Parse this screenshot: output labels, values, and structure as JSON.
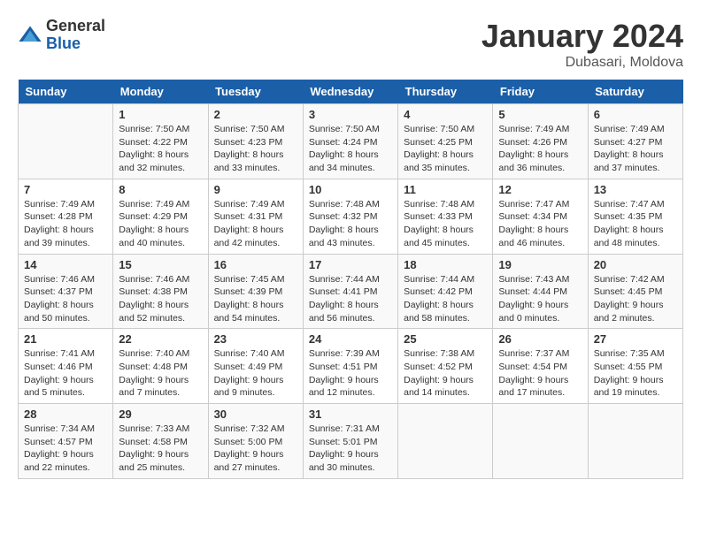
{
  "header": {
    "logo_general": "General",
    "logo_blue": "Blue",
    "month_title": "January 2024",
    "location": "Dubasari, Moldova"
  },
  "weekdays": [
    "Sunday",
    "Monday",
    "Tuesday",
    "Wednesday",
    "Thursday",
    "Friday",
    "Saturday"
  ],
  "weeks": [
    [
      {
        "day": "",
        "sunrise": "",
        "sunset": "",
        "daylight": ""
      },
      {
        "day": "1",
        "sunrise": "Sunrise: 7:50 AM",
        "sunset": "Sunset: 4:22 PM",
        "daylight": "Daylight: 8 hours and 32 minutes."
      },
      {
        "day": "2",
        "sunrise": "Sunrise: 7:50 AM",
        "sunset": "Sunset: 4:23 PM",
        "daylight": "Daylight: 8 hours and 33 minutes."
      },
      {
        "day": "3",
        "sunrise": "Sunrise: 7:50 AM",
        "sunset": "Sunset: 4:24 PM",
        "daylight": "Daylight: 8 hours and 34 minutes."
      },
      {
        "day": "4",
        "sunrise": "Sunrise: 7:50 AM",
        "sunset": "Sunset: 4:25 PM",
        "daylight": "Daylight: 8 hours and 35 minutes."
      },
      {
        "day": "5",
        "sunrise": "Sunrise: 7:49 AM",
        "sunset": "Sunset: 4:26 PM",
        "daylight": "Daylight: 8 hours and 36 minutes."
      },
      {
        "day": "6",
        "sunrise": "Sunrise: 7:49 AM",
        "sunset": "Sunset: 4:27 PM",
        "daylight": "Daylight: 8 hours and 37 minutes."
      }
    ],
    [
      {
        "day": "7",
        "sunrise": "Sunrise: 7:49 AM",
        "sunset": "Sunset: 4:28 PM",
        "daylight": "Daylight: 8 hours and 39 minutes."
      },
      {
        "day": "8",
        "sunrise": "Sunrise: 7:49 AM",
        "sunset": "Sunset: 4:29 PM",
        "daylight": "Daylight: 8 hours and 40 minutes."
      },
      {
        "day": "9",
        "sunrise": "Sunrise: 7:49 AM",
        "sunset": "Sunset: 4:31 PM",
        "daylight": "Daylight: 8 hours and 42 minutes."
      },
      {
        "day": "10",
        "sunrise": "Sunrise: 7:48 AM",
        "sunset": "Sunset: 4:32 PM",
        "daylight": "Daylight: 8 hours and 43 minutes."
      },
      {
        "day": "11",
        "sunrise": "Sunrise: 7:48 AM",
        "sunset": "Sunset: 4:33 PM",
        "daylight": "Daylight: 8 hours and 45 minutes."
      },
      {
        "day": "12",
        "sunrise": "Sunrise: 7:47 AM",
        "sunset": "Sunset: 4:34 PM",
        "daylight": "Daylight: 8 hours and 46 minutes."
      },
      {
        "day": "13",
        "sunrise": "Sunrise: 7:47 AM",
        "sunset": "Sunset: 4:35 PM",
        "daylight": "Daylight: 8 hours and 48 minutes."
      }
    ],
    [
      {
        "day": "14",
        "sunrise": "Sunrise: 7:46 AM",
        "sunset": "Sunset: 4:37 PM",
        "daylight": "Daylight: 8 hours and 50 minutes."
      },
      {
        "day": "15",
        "sunrise": "Sunrise: 7:46 AM",
        "sunset": "Sunset: 4:38 PM",
        "daylight": "Daylight: 8 hours and 52 minutes."
      },
      {
        "day": "16",
        "sunrise": "Sunrise: 7:45 AM",
        "sunset": "Sunset: 4:39 PM",
        "daylight": "Daylight: 8 hours and 54 minutes."
      },
      {
        "day": "17",
        "sunrise": "Sunrise: 7:44 AM",
        "sunset": "Sunset: 4:41 PM",
        "daylight": "Daylight: 8 hours and 56 minutes."
      },
      {
        "day": "18",
        "sunrise": "Sunrise: 7:44 AM",
        "sunset": "Sunset: 4:42 PM",
        "daylight": "Daylight: 8 hours and 58 minutes."
      },
      {
        "day": "19",
        "sunrise": "Sunrise: 7:43 AM",
        "sunset": "Sunset: 4:44 PM",
        "daylight": "Daylight: 9 hours and 0 minutes."
      },
      {
        "day": "20",
        "sunrise": "Sunrise: 7:42 AM",
        "sunset": "Sunset: 4:45 PM",
        "daylight": "Daylight: 9 hours and 2 minutes."
      }
    ],
    [
      {
        "day": "21",
        "sunrise": "Sunrise: 7:41 AM",
        "sunset": "Sunset: 4:46 PM",
        "daylight": "Daylight: 9 hours and 5 minutes."
      },
      {
        "day": "22",
        "sunrise": "Sunrise: 7:40 AM",
        "sunset": "Sunset: 4:48 PM",
        "daylight": "Daylight: 9 hours and 7 minutes."
      },
      {
        "day": "23",
        "sunrise": "Sunrise: 7:40 AM",
        "sunset": "Sunset: 4:49 PM",
        "daylight": "Daylight: 9 hours and 9 minutes."
      },
      {
        "day": "24",
        "sunrise": "Sunrise: 7:39 AM",
        "sunset": "Sunset: 4:51 PM",
        "daylight": "Daylight: 9 hours and 12 minutes."
      },
      {
        "day": "25",
        "sunrise": "Sunrise: 7:38 AM",
        "sunset": "Sunset: 4:52 PM",
        "daylight": "Daylight: 9 hours and 14 minutes."
      },
      {
        "day": "26",
        "sunrise": "Sunrise: 7:37 AM",
        "sunset": "Sunset: 4:54 PM",
        "daylight": "Daylight: 9 hours and 17 minutes."
      },
      {
        "day": "27",
        "sunrise": "Sunrise: 7:35 AM",
        "sunset": "Sunset: 4:55 PM",
        "daylight": "Daylight: 9 hours and 19 minutes."
      }
    ],
    [
      {
        "day": "28",
        "sunrise": "Sunrise: 7:34 AM",
        "sunset": "Sunset: 4:57 PM",
        "daylight": "Daylight: 9 hours and 22 minutes."
      },
      {
        "day": "29",
        "sunrise": "Sunrise: 7:33 AM",
        "sunset": "Sunset: 4:58 PM",
        "daylight": "Daylight: 9 hours and 25 minutes."
      },
      {
        "day": "30",
        "sunrise": "Sunrise: 7:32 AM",
        "sunset": "Sunset: 5:00 PM",
        "daylight": "Daylight: 9 hours and 27 minutes."
      },
      {
        "day": "31",
        "sunrise": "Sunrise: 7:31 AM",
        "sunset": "Sunset: 5:01 PM",
        "daylight": "Daylight: 9 hours and 30 minutes."
      },
      {
        "day": "",
        "sunrise": "",
        "sunset": "",
        "daylight": ""
      },
      {
        "day": "",
        "sunrise": "",
        "sunset": "",
        "daylight": ""
      },
      {
        "day": "",
        "sunrise": "",
        "sunset": "",
        "daylight": ""
      }
    ]
  ]
}
